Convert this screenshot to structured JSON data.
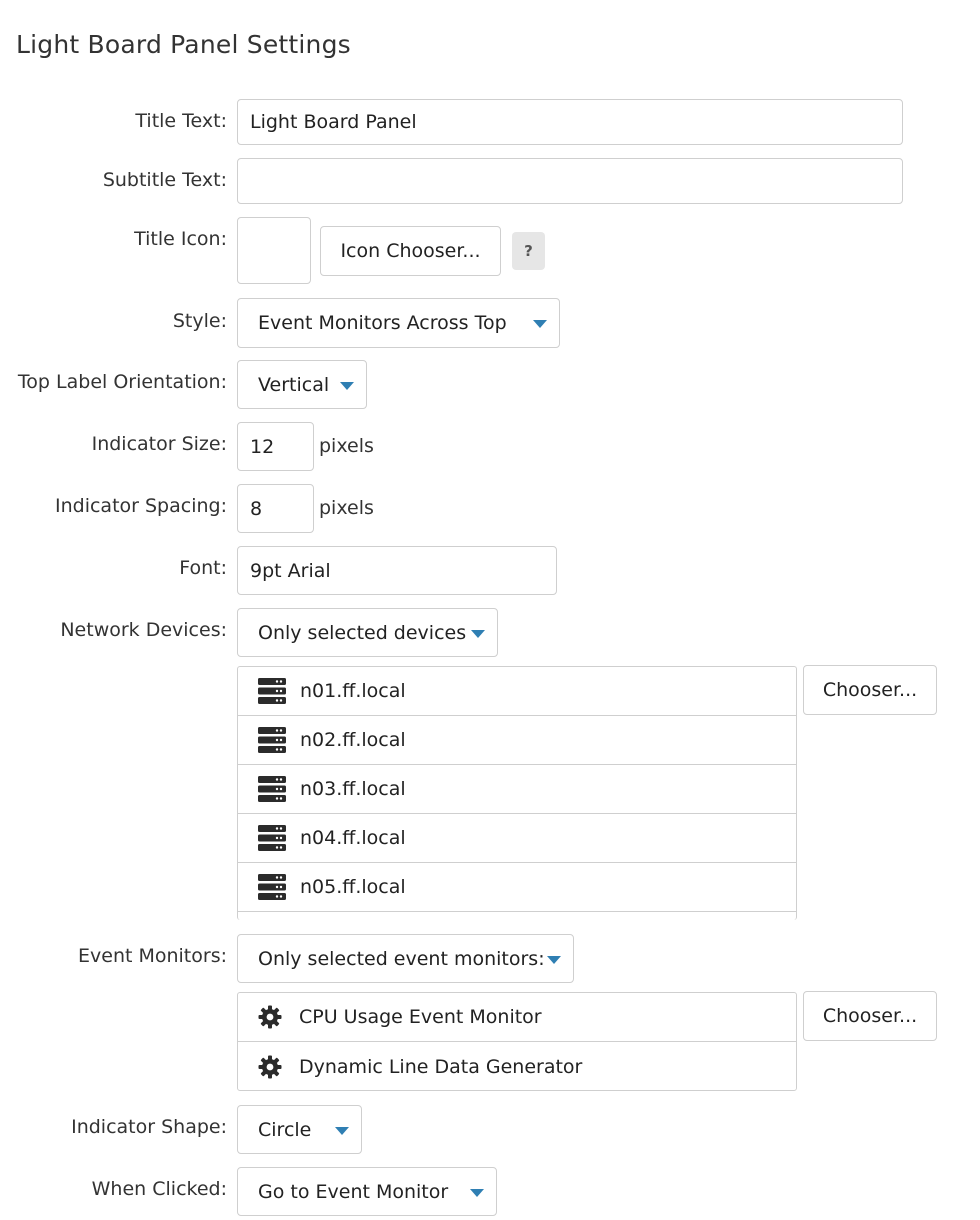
{
  "page": {
    "title": "Light Board Panel Settings"
  },
  "fields": {
    "title_text": {
      "label": "Title Text:",
      "value": "Light Board Panel"
    },
    "subtitle_text": {
      "label": "Subtitle Text:",
      "value": ""
    },
    "title_icon": {
      "label": "Title Icon:",
      "chooser_label": "Icon Chooser...",
      "help_label": "?"
    },
    "style": {
      "label": "Style:",
      "selected": "Event Monitors Across Top"
    },
    "top_label_orientation": {
      "label": "Top Label Orientation:",
      "selected": "Vertical"
    },
    "indicator_size": {
      "label": "Indicator Size:",
      "value": "12",
      "unit": "pixels"
    },
    "indicator_spacing": {
      "label": "Indicator Spacing:",
      "value": "8",
      "unit": "pixels"
    },
    "font": {
      "label": "Font:",
      "value": "9pt Arial"
    },
    "network_devices": {
      "label": "Network Devices:",
      "selected": "Only selected devices",
      "chooser_label": "Chooser...",
      "items": [
        "n01.ff.local",
        "n02.ff.local",
        "n03.ff.local",
        "n04.ff.local",
        "n05.ff.local"
      ],
      "item_icon": "server-icon"
    },
    "event_monitors": {
      "label": "Event Monitors:",
      "selected": "Only selected event monitors:",
      "chooser_label": "Chooser...",
      "items": [
        "CPU Usage Event Monitor",
        "Dynamic Line Data Generator"
      ],
      "item_icon": "gear-icon"
    },
    "indicator_shape": {
      "label": "Indicator Shape:",
      "selected": "Circle"
    },
    "when_clicked": {
      "label": "When Clicked:",
      "selected": "Go to Event Monitor"
    }
  },
  "colors": {
    "accent": "#2f7fb3",
    "border": "#cfcfcf",
    "help_bg": "#e6e6e6"
  }
}
